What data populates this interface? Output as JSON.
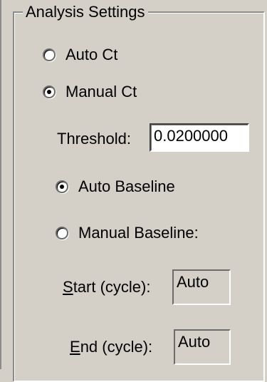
{
  "analysis_settings": {
    "title": "Analysis Settings",
    "ct_mode": {
      "auto_label": "Auto Ct",
      "manual_label": "Manual Ct",
      "selected": "manual"
    },
    "threshold": {
      "label": "Threshold:",
      "value": "0.0200000"
    },
    "baseline_mode": {
      "auto_label": "Auto Baseline",
      "manual_label": "Manual Baseline:",
      "selected": "auto"
    },
    "start_cycle": {
      "label_mnemonic": "S",
      "label_rest": "tart (cycle):",
      "value": "Auto"
    },
    "end_cycle": {
      "label_mnemonic": "E",
      "label_rest": "nd (cycle):",
      "value": "Auto"
    }
  }
}
